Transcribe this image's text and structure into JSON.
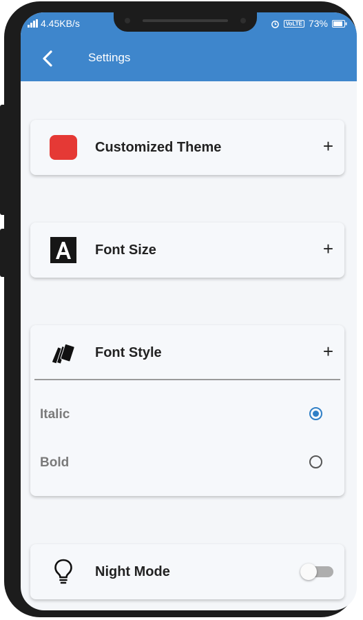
{
  "status_bar": {
    "network_speed": "4.45KB/s",
    "volte": "VoLTE",
    "battery": "73%",
    "color": "#3e86cc"
  },
  "appbar": {
    "title": "Settings",
    "back_icon": "chevron-left-icon"
  },
  "settings": {
    "customized_theme": {
      "label": "Customized Theme",
      "expand": "+",
      "icon": "red-square-icon",
      "swatch_color": "#e53935"
    },
    "font_size": {
      "label": "Font Size",
      "expand": "+",
      "icon": "letter-a-icon"
    },
    "font_style": {
      "label": "Font Style",
      "expand": "+",
      "icon": "cards-icon",
      "options": [
        {
          "label": "Italic",
          "selected": true
        },
        {
          "label": "Bold",
          "selected": false
        }
      ]
    },
    "night_mode": {
      "label": "Night Mode",
      "icon": "lightbulb-icon",
      "enabled": false
    }
  },
  "accent_color": "#2f7fc6"
}
